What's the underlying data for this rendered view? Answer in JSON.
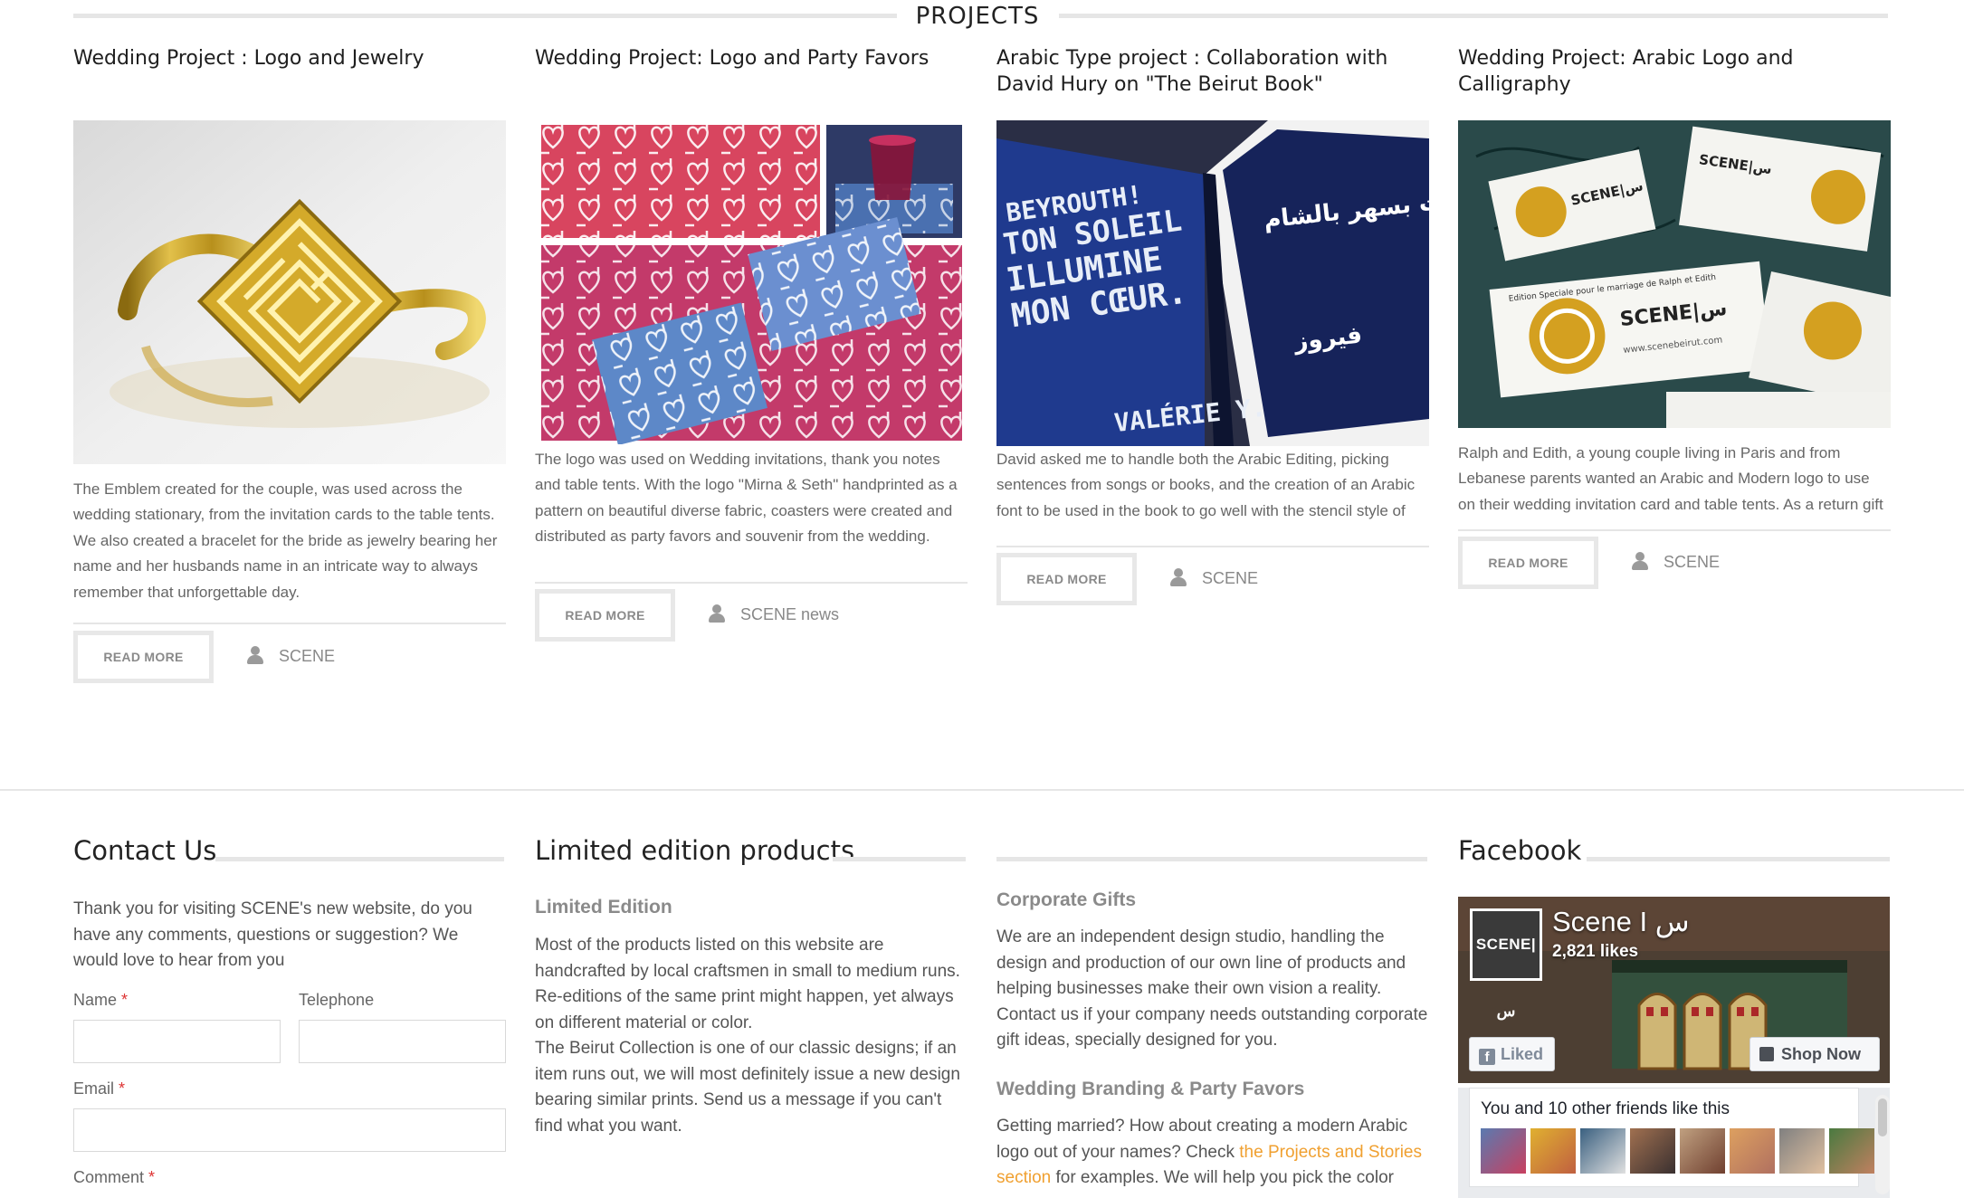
{
  "projects": {
    "title": "PROJECTS",
    "cards": [
      {
        "title": "Wedding Project : Logo and Jewelry",
        "text": "The Emblem created for the couple, was used across the wedding stationary, from the invitation cards to the table tents. We also created a bracelet for the bride as jewelry bearing her name and her husbands name in an intricate way to always remember that unforgettable day.",
        "read_more": "READ MORE",
        "author": "SCENE"
      },
      {
        "title": "Wedding Project: Logo and Party Favors",
        "text": "The logo was used on Wedding invitations, thank you notes and table tents. With the logo \"Mirna & Seth\" handprinted as a pattern on beautiful diverse fabric, coasters were created and distributed as party favors and souvenir from the wedding.",
        "read_more": "READ MORE",
        "author": "SCENE news"
      },
      {
        "title": "Arabic Type project : Collaboration with David Hury on \"The Beirut Book\"",
        "text": "David asked me to handle both the Arabic Editing, picking sentences from songs or books, and the creation of an Arabic font to be used in the book to go well with the stencil style of",
        "read_more": "READ MORE",
        "author": "SCENE",
        "image_text": {
          "line1": "BEYROUTH!",
          "line2": "TON SOLEIL",
          "line3": "ILLUMINE",
          "line4": "MON CŒUR.",
          "author": "VALÉRIE Y.",
          "arabic": "إنّ ما سهرنا بيروت بسهر بالشام.",
          "arabic_sign": "فيروز"
        }
      },
      {
        "title": "Wedding Project: Arabic Logo and Calligraphy",
        "text": "Ralph and Edith, a young couple living in Paris and from Lebanese parents wanted an Arabic and Modern logo to use on their wedding invitation card and table tents. As a return gift",
        "read_more": "READ MORE",
        "author": "SCENE",
        "image_text": {
          "brand": "SCENE|س",
          "tag": "Edition Speciale pour le marriage de Ralph et Edith",
          "url": "www.scenebeirut.com"
        }
      }
    ]
  },
  "footer": {
    "contact": {
      "heading": "Contact Us",
      "intro": "Thank you for visiting SCENE's new website, do you have any comments, questions or suggestion? We would love to hear from you",
      "name_label": "Name",
      "telephone_label": "Telephone",
      "email_label": "Email",
      "comment_label": "Comment",
      "required_mark": "*"
    },
    "limited": {
      "heading": "Limited edition products",
      "sub_heading": "Limited Edition",
      "text": "Most of the products listed on this website are handcrafted by local craftsmen in small to medium runs. Re-editions of the same print might happen, yet always on different material or color.\nThe Beirut Collection is one of our classic designs; if an item runs out, we will most definitely issue a new design bearing similar prints. Send us a message if you can't find what you want."
    },
    "corporate": {
      "sub_heading": "Corporate Gifts",
      "text": "We are an independent design studio, handling the design and production of our own line of products and helping businesses make their own vision a reality. Contact us if your company needs outstanding corporate gift ideas, specially designed for you.",
      "sub_heading_2": "Wedding Branding & Party Favors",
      "text_2_before": "Getting married? How about creating a modern Arabic logo out of your names? Check ",
      "text_2_link": "the Projects and Stories section",
      "text_2_after": " for examples. We will help you pick the color"
    },
    "facebook": {
      "heading": "Facebook",
      "page_name": "Scene I س",
      "likes": "2,821 likes",
      "logo_text": "SCENE|س",
      "liked_label": "Liked",
      "shop_label": "Shop Now",
      "friends_text": "You and 10 other friends like this"
    }
  },
  "colors": {
    "accent_link": "#f0a030",
    "required": "#dd3333",
    "rule": "#e6e6e6"
  }
}
